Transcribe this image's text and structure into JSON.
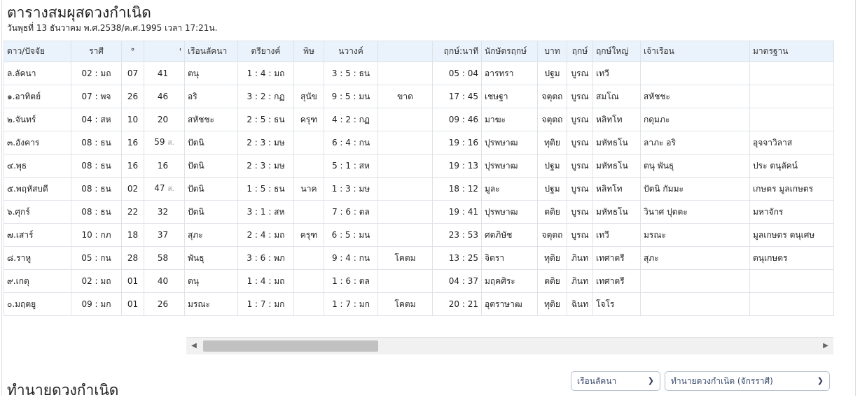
{
  "header": {
    "title": "ตารางสมผุสดวงกำเนิด",
    "subtitle": "วันพุธที่ 13 ธันวาคม พ.ศ.2538/ค.ศ.1995 เวลา 17:21น."
  },
  "table": {
    "columns": [
      "ดาว/ปัจจัย",
      "ราศี",
      "°",
      "'",
      "เรือนลัคนา",
      "ตรียางค์",
      "พิษ",
      "นวางค์",
      "",
      "ฤกษ์:นาที",
      "นักษัตรฤกษ์",
      "บาท",
      "ฤกษ์",
      "ฤกษ์ใหญ่",
      "เจ้าเรือน",
      "มาตรฐาน"
    ],
    "rows": [
      [
        "ล.ลัคนา",
        "02 : มถ",
        "07",
        "41",
        "",
        "ตนุ",
        "1 : 4 : มถ",
        "",
        "3 : 5 : ธน",
        "",
        "05 : 04",
        "อารทรา",
        "ปฐม",
        "บูรณ",
        "เทวี",
        "",
        ""
      ],
      [
        "๑.อาทิตย์",
        "07 : พจ",
        "26",
        "46",
        "",
        "อริ",
        "3 : 2 : กฏ",
        "สุนัข",
        "9 : 5 : มน",
        "ขาด",
        "17 : 45",
        "เชษฐา",
        "จตุตถ",
        "บูรณ",
        "สมโณ",
        "สหัชชะ",
        ""
      ],
      [
        "๒.จันทร์",
        "04 : สห",
        "10",
        "20",
        "",
        "สหัชชะ",
        "2 : 5 : ธน",
        "ครุฑ",
        "4 : 2 : กฏ",
        "",
        "09 : 46",
        "มาฆะ",
        "จตุตถ",
        "บูรณ",
        "หลิทโท",
        "กดุมภะ",
        ""
      ],
      [
        "๓.อังคาร",
        "08 : ธน",
        "16",
        "59",
        "ส.",
        "ปัตนิ",
        "2 : 3 : มษ",
        "",
        "6 : 4 : กน",
        "",
        "19 : 16",
        "ปุรพษาฒ",
        "ทุติย",
        "บูรณ",
        "มหัทธโน",
        "ลาภะ อริ",
        "อุจจาวิลาส"
      ],
      [
        "๔.พุธ",
        "08 : ธน",
        "16",
        "16",
        "",
        "ปัตนิ",
        "2 : 3 : มษ",
        "",
        "5 : 1 : สห",
        "",
        "19 : 13",
        "ปุรพษาฒ",
        "ปฐม",
        "บูรณ",
        "มหัทธโน",
        "ตนุ พันธุ",
        "ประ ตนุลัคน์"
      ],
      [
        "๕.พฤหัสบดี",
        "08 : ธน",
        "02",
        "47",
        "ส.",
        "ปัตนิ",
        "1 : 5 : ธน",
        "นาค",
        "1 : 3 : มษ",
        "",
        "18 : 12",
        "มูละ",
        "ปฐม",
        "บูรณ",
        "หลิทโท",
        "ปัตนิ กัมมะ",
        "เกษตร มูลเกษตร"
      ],
      [
        "๖.ศุกร์",
        "08 : ธน",
        "22",
        "32",
        "",
        "ปัตนิ",
        "3 : 1 : สห",
        "",
        "7 : 6 : ตล",
        "",
        "19 : 41",
        "ปุรพษาฒ",
        "ตติย",
        "บูรณ",
        "มหัทธโน",
        "วินาศ ปุตตะ",
        "มหาจักร"
      ],
      [
        "๗.เสาร์",
        "10 : กภ",
        "18",
        "37",
        "",
        "สุภะ",
        "2 : 4 : มถ",
        "ครุฑ",
        "6 : 5 : มน",
        "",
        "23 : 53",
        "ศตภิษัช",
        "จตุตถ",
        "บูรณ",
        "เทวี",
        "มรณะ",
        "มูลเกษตร ตนุเศษ"
      ],
      [
        "๘.ราหู",
        "05 : กน",
        "28",
        "58",
        "",
        "พันธุ",
        "3 : 6 : พภ",
        "",
        "9 : 4 : กน",
        "โคตม",
        "13 : 25",
        "จิตรา",
        "ทุติย",
        "ภินท",
        "เทศาตรี",
        "สุภะ",
        "ตนุเกษตร"
      ],
      [
        "๙.เกตุ",
        "02 : มถ",
        "01",
        "40",
        "",
        "ตนุ",
        "1 : 4 : มถ",
        "",
        "1 : 6 : ตล",
        "",
        "04 : 37",
        "มฤคศิระ",
        "ตติย",
        "ภินท",
        "เทศาตรี",
        "",
        ""
      ],
      [
        "๐.มฤตยู",
        "09 : มก",
        "01",
        "26",
        "",
        "มรณะ",
        "1 : 7 : มก",
        "",
        "1 : 7 : มก",
        "โคตม",
        "20 : 21",
        "อุตราษาฒ",
        "ทุติย",
        "ฉินท",
        "โจโร",
        "",
        ""
      ]
    ]
  },
  "scrollbar": {
    "left_icon": "arrow-left-icon",
    "right_icon": "arrow-right-icon",
    "position": 0.0
  },
  "footer": {
    "section_title": "ทำนายดวงกำเนิด",
    "select1": {
      "value": "เรือนลัคนา",
      "icon": "chevron-down-icon"
    },
    "select2": {
      "value": "ทำนายดวงกำเนิด (จักรราศี)",
      "icon": "chevron-down-icon"
    }
  }
}
